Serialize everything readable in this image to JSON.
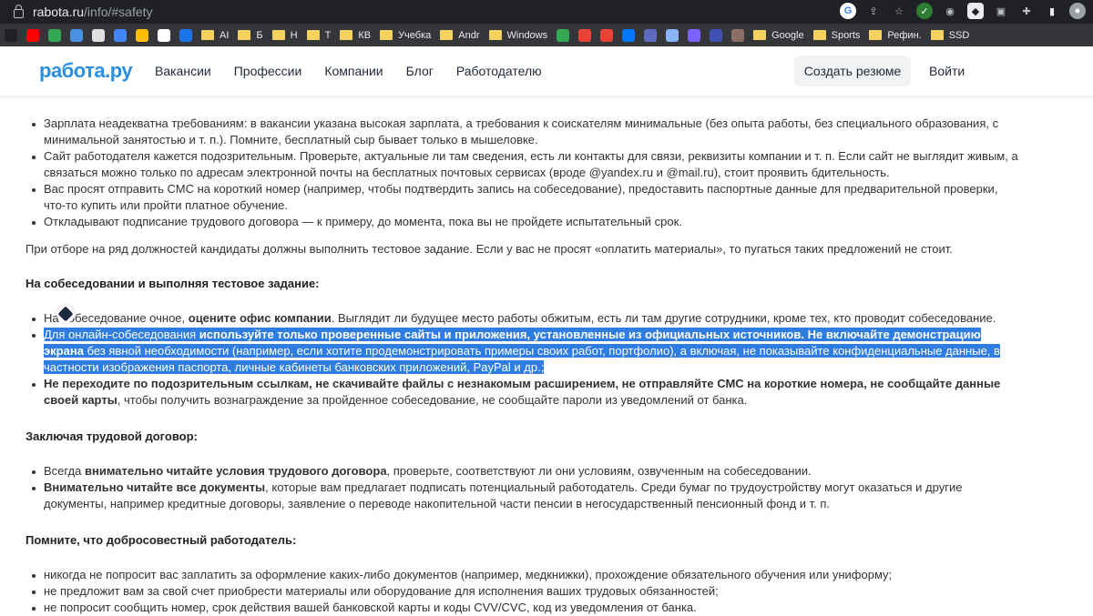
{
  "browser": {
    "url_host": "rabota.ru",
    "url_path": "/info/#safety",
    "bookmarks": [
      {
        "label": "",
        "icon": "plus-icon",
        "color": "#202124"
      },
      {
        "label": "",
        "icon": "youtube-icon",
        "color": "#ff0000"
      },
      {
        "label": "",
        "icon": "drive-icon",
        "color": "#34a853"
      },
      {
        "label": "",
        "icon": "bird-icon",
        "color": "#4a90e2"
      },
      {
        "label": "",
        "icon": "calendar-icon",
        "color": "#e0e0e0"
      },
      {
        "label": "",
        "icon": "docs-icon",
        "color": "#4285f4"
      },
      {
        "label": "",
        "icon": "circle-icon",
        "color": "#fbbc05"
      },
      {
        "label": "",
        "icon": "google-icon",
        "color": "#ffffff"
      },
      {
        "label": "",
        "icon": "s-icon",
        "color": "#1a73e8"
      },
      {
        "label": "AI",
        "icon": "folder-icon",
        "color": "#f6d360"
      },
      {
        "label": "Б",
        "icon": "folder-icon",
        "color": "#f6d360"
      },
      {
        "label": "Н",
        "icon": "folder-icon",
        "color": "#f6d360"
      },
      {
        "label": "Т",
        "icon": "folder-icon",
        "color": "#f6d360"
      },
      {
        "label": "КВ",
        "icon": "folder-icon",
        "color": "#f6d360"
      },
      {
        "label": "Учебка",
        "icon": "folder-icon",
        "color": "#f6d360"
      },
      {
        "label": "Andr",
        "icon": "folder-icon",
        "color": "#f6d360"
      },
      {
        "label": "Windows",
        "icon": "folder-icon",
        "color": "#f6d360"
      },
      {
        "label": "",
        "icon": "dots-icon",
        "color": "#34a853"
      },
      {
        "label": "",
        "icon": "pin-icon",
        "color": "#ea4335"
      },
      {
        "label": "",
        "icon": "pin-icon",
        "color": "#ea4335"
      },
      {
        "label": "",
        "icon": "vk-icon",
        "color": "#0077ff"
      },
      {
        "label": "",
        "icon": "four-icon",
        "color": "#5c6bc0"
      },
      {
        "label": "",
        "icon": "sparkle-icon",
        "color": "#8ab4f8"
      },
      {
        "label": "",
        "icon": "gem-icon",
        "color": "#7b61ff"
      },
      {
        "label": "",
        "icon": "cube-icon",
        "color": "#3f51b5"
      },
      {
        "label": "",
        "icon": "photo-icon",
        "color": "#8d6e63"
      },
      {
        "label": "Google",
        "icon": "folder-icon",
        "color": "#f6d360"
      },
      {
        "label": "Sports",
        "icon": "folder-icon",
        "color": "#f6d360"
      },
      {
        "label": "Рефин.",
        "icon": "folder-icon",
        "color": "#f6d360"
      },
      {
        "label": "SSD",
        "icon": "folder-icon",
        "color": "#f6d360"
      }
    ]
  },
  "header": {
    "logo": "работа.ру",
    "nav": [
      "Вакансии",
      "Профессии",
      "Компании",
      "Блог",
      "Работодателю"
    ],
    "cta": "Создать резюме",
    "login": "Войти"
  },
  "article": {
    "list1": [
      "Зарплата неадекватна требованиям: в вакансии указана высокая зарплата, а требования к соискателям минимальные (без опыта работы, без специального образования, с минимальной занятостью и т. п.). Помните, бесплатный сыр бывает только в мышеловке.",
      "Сайт работодателя кажется подозрительным. Проверьте, актуальные ли там сведения, есть ли контакты для связи, реквизиты компании и т. п. Если сайт не выглядит живым, а связаться можно только по адресам электронной почты на бесплатных почтовых сервисах (вроде @yandex.ru и @mail.ru), стоит проявить бдительность.",
      "Вас просят отправить СМС на короткий номер (например, чтобы подтвердить запись на собеседование), предоставить паспортные данные для предварительной проверки, что-то купить или пройти платное обучение.",
      "Откладывают подписание трудового договора — к примеру, до момента, пока вы не пройдете испытательный срок."
    ],
    "para1": "При отборе на ряд должностей кандидаты должны выполнить тестовое задание. Если у вас не просят «оплатить материалы», то пугаться таких предложений не стоит.",
    "h1": "На собеседовании и выполняя тестовое задание:",
    "s2_li1_a": "На собеседование очное, ",
    "s2_li1_b": "оцените офис компании",
    "s2_li1_c": ". Выглядит ли будущее место работы обжитым, есть ли там другие сотрудники, кроме тех, кто проводит собеседование.",
    "s2_li2_a": "Для онлайн-собеседования ",
    "s2_li2_b": "используйте только проверенные сайты и приложения, установленные из официальных источников. Не включайте демонстрацию экрана",
    "s2_li2_c": " без явной необходимости (например, если хотите продемонстрировать примеры своих работ, портфолио), а включая, не показывайте конфиденциальные данные, в частности изображения паспорта, личные кабинеты банковских приложений, PayPal и др.;",
    "s2_li3_b": "Не переходите по подозрительным ссылкам, не скачивайте файлы с незнакомым расширением, не отправляйте СМС на короткие номера, не сообщайте данные своей карты",
    "s2_li3_c": ", чтобы получить вознаграждение за пройденное собеседование, не сообщайте пароли из уведомлений от банка.",
    "h2": "Заключая трудовой договор:",
    "s3_li1_a": "Всегда ",
    "s3_li1_b": "внимательно читайте условия трудового договора",
    "s3_li1_c": ", проверьте, соответствуют ли они условиям, озвученным на собеседовании.",
    "s3_li2_b": "Внимательно читайте все документы",
    "s3_li2_c": ", которые вам предлагает подписать потенциальный работодатель. Среди бумаг по трудоустройству могут оказаться и другие документы, например кредитные договоры, заявление о переводе накопительной части пенсии в негосударственный пенсионный фонд и т. п.",
    "h3": "Помните, что добросовестный работодатель:",
    "list4": [
      "никогда не попросит вас заплатить за оформление каких-либо документов (например, медкнижки), прохождение обязательного обучения или униформу;",
      "не предложит вам за свой счет приобрести материалы или оборудование для исполнения ваших трудовых обязанностей;",
      "не попросит сообщить номер, срок действия вашей банковской карты и коды CVV/CVC, код из уведомления от банка."
    ]
  }
}
